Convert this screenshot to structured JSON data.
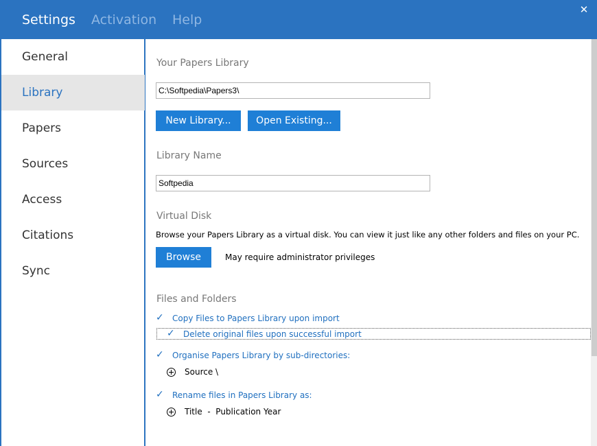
{
  "header": {
    "tabs": [
      {
        "label": "Settings",
        "active": true
      },
      {
        "label": "Activation",
        "active": false
      },
      {
        "label": "Help",
        "active": false
      }
    ],
    "close_label": "✕"
  },
  "sidebar": {
    "items": [
      {
        "label": "General"
      },
      {
        "label": "Library",
        "active": true
      },
      {
        "label": "Papers"
      },
      {
        "label": "Sources"
      },
      {
        "label": "Access"
      },
      {
        "label": "Citations"
      },
      {
        "label": "Sync"
      }
    ]
  },
  "library": {
    "location_title": "Your Papers Library",
    "location_value": "C:\\Softpedia\\Papers3\\",
    "new_library_label": "New Library...",
    "open_existing_label": "Open Existing...",
    "name_title": "Library Name",
    "name_value": "Softpedia",
    "virtual_disk_title": "Virtual Disk",
    "virtual_disk_desc": "Browse your Papers Library as a virtual disk. You can view it just like any other folders and files on your PC.",
    "browse_label": "Browse",
    "admin_note": "May require administrator privileges",
    "files_title": "Files and Folders",
    "copy_files_label": "Copy Files to Papers Library upon import",
    "delete_original_label": "Delete original files upon successful import",
    "organise_label": "Organise Papers Library by sub-directories:",
    "organise_pattern": "Source \\",
    "rename_label": "Rename files in Papers Library as:",
    "rename_pattern": "Title  -  Publication Year",
    "check_glyph": "✓",
    "accent_color": "#1f7fd6",
    "titlebar_color": "#2b73c0"
  }
}
